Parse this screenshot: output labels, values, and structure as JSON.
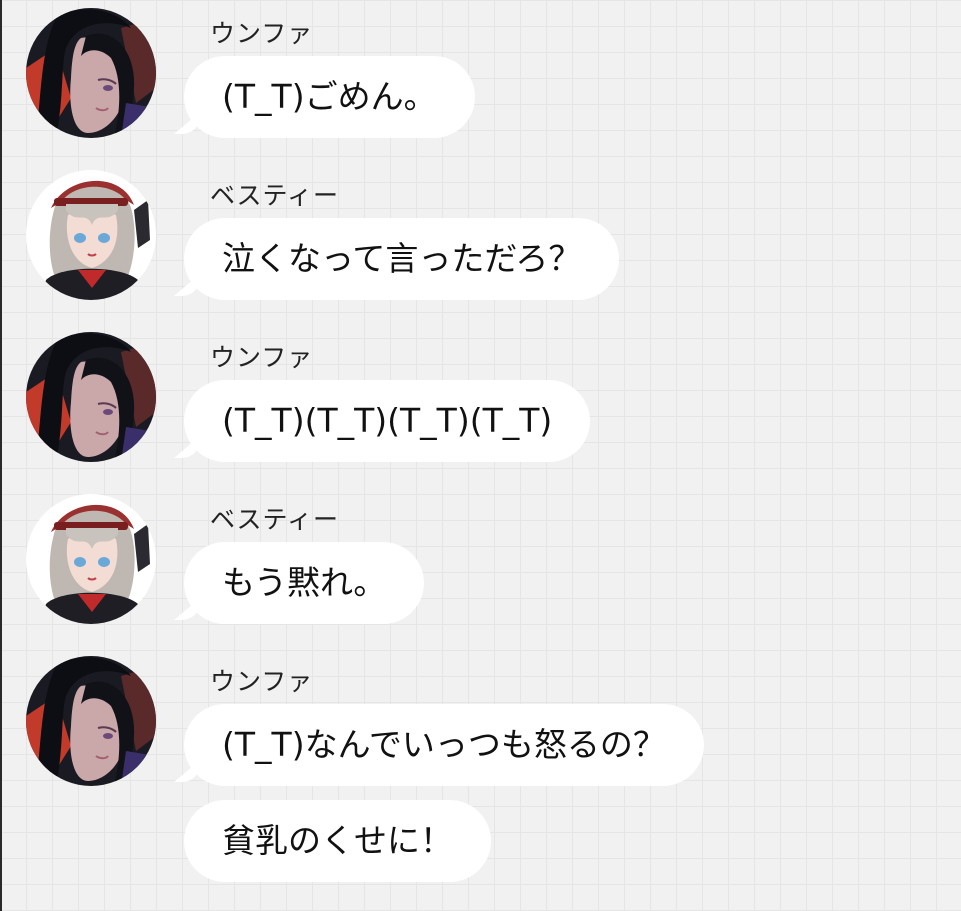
{
  "messages": [
    {
      "sender": "ウンファ",
      "avatar": "dark-haired-girl-avatar",
      "bubbles": [
        "(T_T)ごめん。"
      ]
    },
    {
      "sender": "ベスティー",
      "avatar": "silver-haired-girl-avatar",
      "bubbles": [
        "泣くなって言っただろ？"
      ]
    },
    {
      "sender": "ウンファ",
      "avatar": "dark-haired-girl-avatar",
      "bubbles": [
        "(T_T)(T_T)(T_T)(T_T)"
      ]
    },
    {
      "sender": "ベスティー",
      "avatar": "silver-haired-girl-avatar",
      "bubbles": [
        "もう黙れ。"
      ]
    },
    {
      "sender": "ウンファ",
      "avatar": "dark-haired-girl-avatar",
      "bubbles": [
        "(T_T)なんでいっつも怒るの？",
        "貧乳のくせに！"
      ]
    }
  ],
  "colors": {
    "background": "#f1f1f1",
    "bubble": "#ffffff",
    "text": "#111111"
  }
}
